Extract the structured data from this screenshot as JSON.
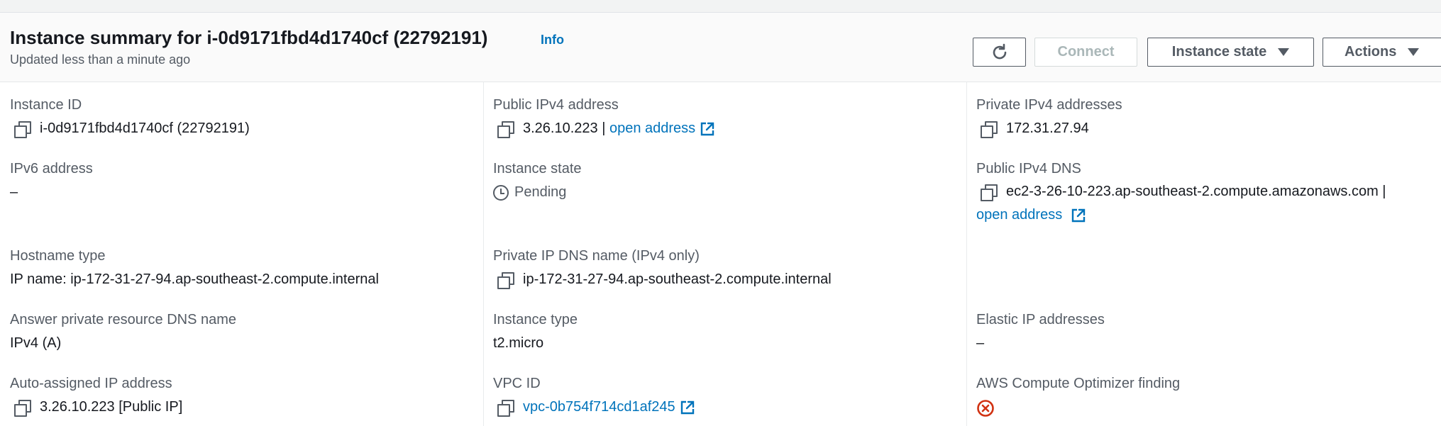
{
  "header": {
    "title": "Instance summary for i-0d9171fbd4d1740cf (22792191)",
    "info_label": "Info",
    "updated": "Updated less than a minute ago"
  },
  "toolbar": {
    "connect_label": "Connect",
    "instance_state_label": "Instance state",
    "actions_label": "Actions"
  },
  "fields": {
    "instance_id": {
      "label": "Instance ID",
      "value": "i-0d9171fbd4d1740cf (22792191)"
    },
    "public_ipv4": {
      "label": "Public IPv4 address",
      "value": "3.26.10.223 |",
      "link": "open address"
    },
    "private_ipv4": {
      "label": "Private IPv4 addresses",
      "value": "172.31.27.94"
    },
    "ipv6": {
      "label": "IPv6 address",
      "value": "–"
    },
    "instance_state": {
      "label": "Instance state",
      "value": "Pending"
    },
    "public_dns": {
      "label": "Public IPv4 DNS",
      "value": "ec2-3-26-10-223.ap-southeast-2.compute.amazonaws.com |",
      "link": "open address"
    },
    "hostname_type": {
      "label": "Hostname type",
      "value": "IP name: ip-172-31-27-94.ap-southeast-2.compute.internal"
    },
    "private_dns": {
      "label": "Private IP DNS name (IPv4 only)",
      "value": "ip-172-31-27-94.ap-southeast-2.compute.internal"
    },
    "answer_dns": {
      "label": "Answer private resource DNS name",
      "value": "IPv4 (A)"
    },
    "instance_type": {
      "label": "Instance type",
      "value": "t2.micro"
    },
    "elastic_ip": {
      "label": "Elastic IP addresses",
      "value": "–"
    },
    "auto_ip": {
      "label": "Auto-assigned IP address",
      "value": "3.26.10.223 [Public IP]"
    },
    "vpc_id": {
      "label": "VPC ID",
      "value": "vpc-0b754f714cd1af245"
    },
    "optimizer": {
      "label": "AWS Compute Optimizer finding"
    }
  },
  "colors": {
    "link": "#0073bb",
    "text": "#16191f",
    "muted": "#545b64",
    "error": "#d13212"
  }
}
